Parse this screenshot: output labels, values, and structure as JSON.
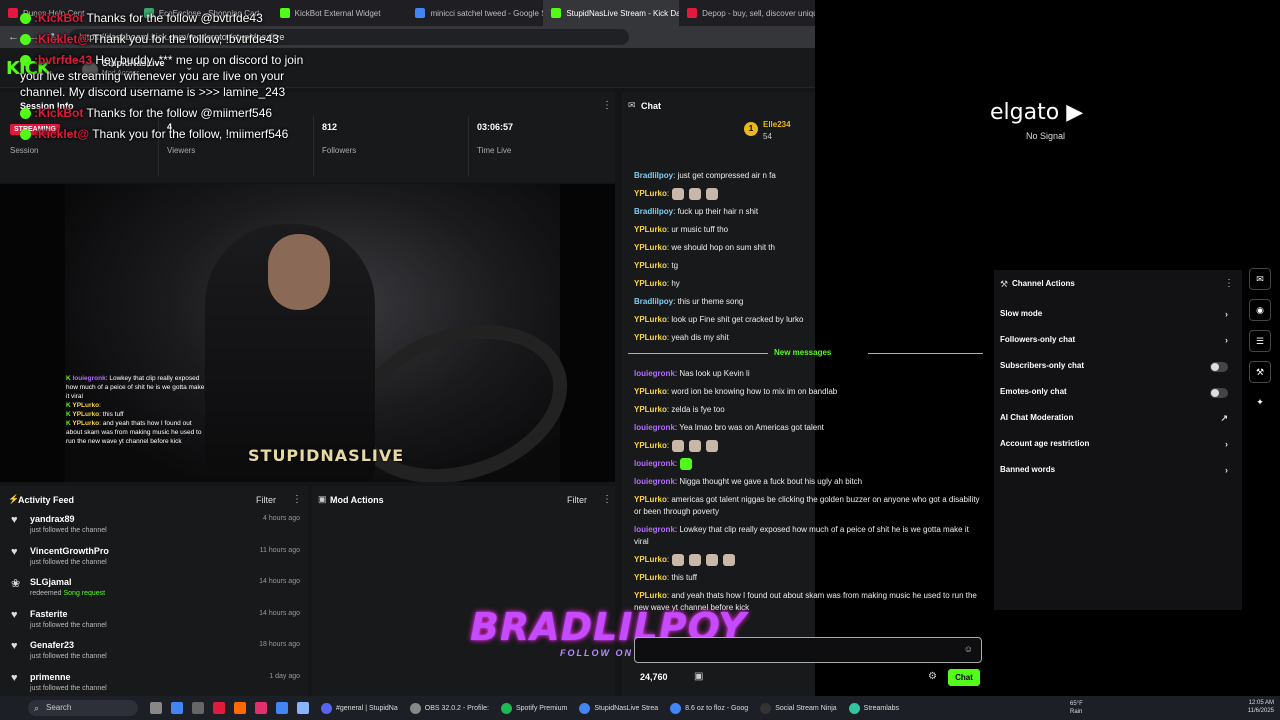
{
  "browser": {
    "tabs": [
      {
        "label": "Dunon Help Cent",
        "color": "#e0193d"
      },
      {
        "label": "EcoEnclose - Shopping Cart",
        "color": "#3aa76d"
      },
      {
        "label": "KickBot External Widget",
        "color": "#53fc18"
      },
      {
        "label": "minicci satchel tweed - Google Shopping",
        "color": "#4285f4"
      },
      {
        "label": "StupidNasLive Stream - Kick Dashboard",
        "color": "#53fc18"
      },
      {
        "label": "Depop - buy, sell, discover unique",
        "color": "#e0193d"
      }
    ],
    "url": "https://dashboard.kick.com/moderator/stupidnaslive"
  },
  "dashboard": {
    "logo": "KICK",
    "channel_name": "StupidNasLive",
    "channel_role": "Mod Access",
    "session": {
      "title": "Session Info",
      "badge": "STREAMING",
      "session_label": "Session",
      "stats": [
        {
          "value": "4",
          "label": "Viewers"
        },
        {
          "value": "812",
          "label": "Followers"
        },
        {
          "value": "03:06:57",
          "label": "Time Live"
        }
      ]
    },
    "video": {
      "overlay_name": "STUPIDNASLIVE",
      "overlay_chat": [
        {
          "user": "louiegronk",
          "text": ": Lowkey that clip really exposed how much of a peice of shit he is we gotta make it viral",
          "cls": "u1"
        },
        {
          "user": "YPLurko",
          "text": ":",
          "cls": "u2"
        },
        {
          "user": "YPLurko",
          "text": ": this tuff",
          "cls": "u2"
        },
        {
          "user": "YPLurko",
          "text": ": and yeah thats how I found out about skam was from making music he used to run the new wave yt channel before kick",
          "cls": "u2"
        }
      ]
    },
    "activity": {
      "title": "Activity Feed",
      "filter": "Filter",
      "items": [
        {
          "icon": "heart",
          "name": "yandrax89",
          "desc": "just followed the channel",
          "highlight": "",
          "time": "4 hours ago"
        },
        {
          "icon": "heart",
          "name": "VincentGrowthPro",
          "desc": "just followed the channel",
          "highlight": "",
          "time": "11 hours ago"
        },
        {
          "icon": "points",
          "name": "SLGjamal",
          "desc": "redeemed",
          "highlight": "Song request",
          "time": "14 hours ago"
        },
        {
          "icon": "heart",
          "name": "Fasterite",
          "desc": "just followed the channel",
          "highlight": "",
          "time": "14 hours ago"
        },
        {
          "icon": "heart",
          "name": "Genafer23",
          "desc": "just followed the channel",
          "highlight": "",
          "time": "18 hours ago"
        },
        {
          "icon": "heart",
          "name": "primenne",
          "desc": "just followed the channel",
          "highlight": "",
          "time": "1 day ago"
        }
      ]
    },
    "mod_actions": {
      "title": "Mod Actions",
      "filter": "Filter"
    },
    "chat": {
      "title": "Chat",
      "pinned": {
        "rank": "1",
        "name": "Elle234",
        "count": "54"
      },
      "messages": [
        {
          "user": "Bradlilpoy",
          "text": ": just get compressed air n fa",
          "cls": "ub",
          "emoji": 0
        },
        {
          "user": "YPLurko",
          "text": ":",
          "cls": "uy",
          "emoji": 3
        },
        {
          "user": "Bradlilpoy",
          "text": ": fuck up their hair n shit",
          "cls": "ub",
          "emoji": 0
        },
        {
          "user": "YPLurko",
          "text": ": ur music tuff tho",
          "cls": "uy",
          "emoji": 0
        },
        {
          "user": "YPLurko",
          "text": ": we should hop on sum shit th",
          "cls": "uy",
          "emoji": 0
        },
        {
          "user": "YPLurko",
          "text": ": tg",
          "cls": "uy",
          "emoji": 0
        },
        {
          "user": "YPLurko",
          "text": ": hy",
          "cls": "uy",
          "emoji": 0
        },
        {
          "user": "Bradlilpoy",
          "text": ": this ur theme song",
          "cls": "ub",
          "emoji": 0
        },
        {
          "user": "YPLurko",
          "text": ": look up Fine shit get cracked by lurko",
          "cls": "uy",
          "emoji": 0
        },
        {
          "user": "YPLurko",
          "text": ": yeah dis my shit",
          "cls": "uy",
          "emoji": 0
        }
      ],
      "new_label": "New messages",
      "new_messages": [
        {
          "user": "louiegronk",
          "text": ": Nas look up Kevin li",
          "cls": "up",
          "emoji": 0
        },
        {
          "user": "YPLurko",
          "text": ": word ion be knowing how to mix im on bandlab",
          "cls": "uy",
          "emoji": 0
        },
        {
          "user": "YPLurko",
          "text": ": zelda is fye too",
          "cls": "uy",
          "emoji": 0
        },
        {
          "user": "louiegronk",
          "text": ": Yea lmao bro was on Americas got talent",
          "cls": "up",
          "emoji": 0
        },
        {
          "user": "YPLurko",
          "text": ":",
          "cls": "uy",
          "emoji": 3
        },
        {
          "user": "louiegronk",
          "text": ":",
          "cls": "up",
          "emoji": 1
        },
        {
          "user": "louiegronk",
          "text": ": Nigga thought we gave a fuck bout his ugly ah bitch",
          "cls": "up",
          "emoji": 0
        },
        {
          "user": "YPLurko",
          "text": ": americas got talent niggas be clicking the golden buzzer on anyone who got a disability or been through poverty",
          "cls": "uy",
          "emoji": 0
        },
        {
          "user": "louiegronk",
          "text": ": Lowkey that clip really exposed how much of a peice of shit he is we gotta make it viral",
          "cls": "up",
          "emoji": 0
        },
        {
          "user": "YPLurko",
          "text": ":",
          "cls": "uy",
          "emoji": 4
        },
        {
          "user": "YPLurko",
          "text": ": this tuff",
          "cls": "uy",
          "emoji": 0
        },
        {
          "user": "YPLurko",
          "text": ": and yeah thats how I found out about skam was from making music he used to run the new wave yt channel before kick",
          "cls": "uy",
          "emoji": 0
        }
      ],
      "points": "24,760",
      "send": "Chat"
    },
    "brand": {
      "big": "BRADLILPOY",
      "small": "FOLLOW ON ALL PLATFORMS"
    }
  },
  "overlay_chat": [
    {
      "user": ":KickBot",
      "text": "Thanks for the follow @bvtrfde43"
    },
    {
      "user": ":Kicklet@",
      "text": "Thank you for the follow, !bvtrfde43"
    },
    {
      "user": ":bvtrfde43",
      "text": "Hey buddy, *** me up on discord to join your live streaming whenever you are live on your channel. My discord username is >>> lamine_243"
    },
    {
      "user": ":KickBot",
      "text": "Thanks for the follow @miimerf546"
    },
    {
      "user": ":Kicklet@",
      "text": "Thank you for the follow, !miimerf546"
    }
  ],
  "elgato": {
    "logo": "elgato",
    "status": "No Signal"
  },
  "channel_actions": {
    "title": "Channel Actions",
    "items": [
      {
        "label": "Slow mode",
        "ctl": "chevron"
      },
      {
        "label": "Followers-only chat",
        "ctl": "chevron"
      },
      {
        "label": "Subscribers-only chat",
        "ctl": "toggle"
      },
      {
        "label": "Emotes-only chat",
        "ctl": "toggle"
      },
      {
        "label": "AI Chat Moderation",
        "ctl": "external"
      },
      {
        "label": "Account age restriction",
        "ctl": "chevron"
      },
      {
        "label": "Banned words",
        "ctl": "chevron"
      }
    ]
  },
  "taskbar": {
    "search": "Search",
    "apps": [
      {
        "label": "#general | StupidNa",
        "color": "#5865f2"
      },
      {
        "label": "OBS 32.0.2 - Profile:",
        "color": "#888"
      },
      {
        "label": "Spotify Premium",
        "color": "#1db954"
      },
      {
        "label": "StupidNasLive Strea",
        "color": "#4285f4"
      },
      {
        "label": "8.6 oz to floz - Goog",
        "color": "#4285f4"
      },
      {
        "label": "Social Stream Ninja",
        "color": "#333"
      },
      {
        "label": "Streamlabs",
        "color": "#31c3a2"
      }
    ],
    "weather_temp": "65°F",
    "weather_text": "Rain",
    "time": "12:05 AM",
    "date": "11/6/2025"
  }
}
